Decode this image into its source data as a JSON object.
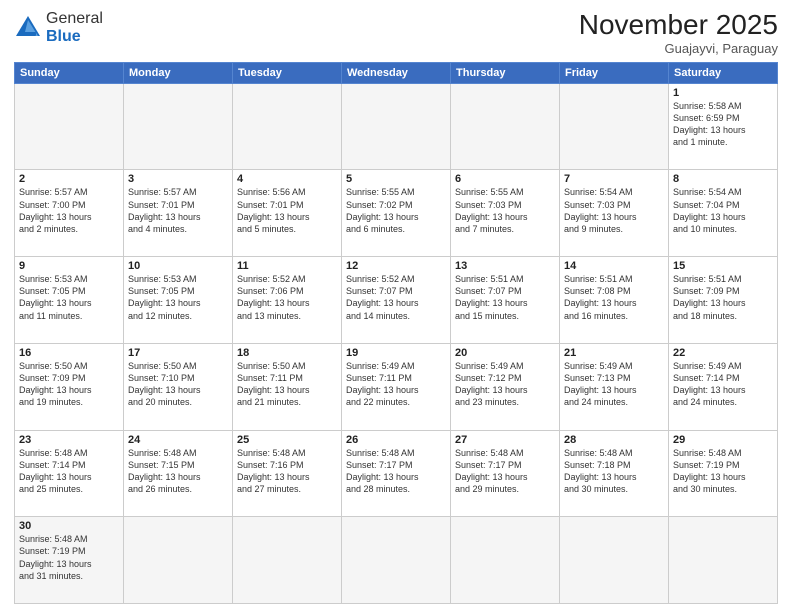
{
  "header": {
    "logo_general": "General",
    "logo_blue": "Blue",
    "month_title": "November 2025",
    "location": "Guajayvi, Paraguay"
  },
  "weekdays": [
    "Sunday",
    "Monday",
    "Tuesday",
    "Wednesday",
    "Thursday",
    "Friday",
    "Saturday"
  ],
  "weeks": [
    [
      {
        "day": "",
        "info": ""
      },
      {
        "day": "",
        "info": ""
      },
      {
        "day": "",
        "info": ""
      },
      {
        "day": "",
        "info": ""
      },
      {
        "day": "",
        "info": ""
      },
      {
        "day": "",
        "info": ""
      },
      {
        "day": "1",
        "info": "Sunrise: 5:58 AM\nSunset: 6:59 PM\nDaylight: 13 hours\nand 1 minute."
      }
    ],
    [
      {
        "day": "2",
        "info": "Sunrise: 5:57 AM\nSunset: 7:00 PM\nDaylight: 13 hours\nand 2 minutes."
      },
      {
        "day": "3",
        "info": "Sunrise: 5:57 AM\nSunset: 7:01 PM\nDaylight: 13 hours\nand 4 minutes."
      },
      {
        "day": "4",
        "info": "Sunrise: 5:56 AM\nSunset: 7:01 PM\nDaylight: 13 hours\nand 5 minutes."
      },
      {
        "day": "5",
        "info": "Sunrise: 5:55 AM\nSunset: 7:02 PM\nDaylight: 13 hours\nand 6 minutes."
      },
      {
        "day": "6",
        "info": "Sunrise: 5:55 AM\nSunset: 7:03 PM\nDaylight: 13 hours\nand 7 minutes."
      },
      {
        "day": "7",
        "info": "Sunrise: 5:54 AM\nSunset: 7:03 PM\nDaylight: 13 hours\nand 9 minutes."
      },
      {
        "day": "8",
        "info": "Sunrise: 5:54 AM\nSunset: 7:04 PM\nDaylight: 13 hours\nand 10 minutes."
      }
    ],
    [
      {
        "day": "9",
        "info": "Sunrise: 5:53 AM\nSunset: 7:05 PM\nDaylight: 13 hours\nand 11 minutes."
      },
      {
        "day": "10",
        "info": "Sunrise: 5:53 AM\nSunset: 7:05 PM\nDaylight: 13 hours\nand 12 minutes."
      },
      {
        "day": "11",
        "info": "Sunrise: 5:52 AM\nSunset: 7:06 PM\nDaylight: 13 hours\nand 13 minutes."
      },
      {
        "day": "12",
        "info": "Sunrise: 5:52 AM\nSunset: 7:07 PM\nDaylight: 13 hours\nand 14 minutes."
      },
      {
        "day": "13",
        "info": "Sunrise: 5:51 AM\nSunset: 7:07 PM\nDaylight: 13 hours\nand 15 minutes."
      },
      {
        "day": "14",
        "info": "Sunrise: 5:51 AM\nSunset: 7:08 PM\nDaylight: 13 hours\nand 16 minutes."
      },
      {
        "day": "15",
        "info": "Sunrise: 5:51 AM\nSunset: 7:09 PM\nDaylight: 13 hours\nand 18 minutes."
      }
    ],
    [
      {
        "day": "16",
        "info": "Sunrise: 5:50 AM\nSunset: 7:09 PM\nDaylight: 13 hours\nand 19 minutes."
      },
      {
        "day": "17",
        "info": "Sunrise: 5:50 AM\nSunset: 7:10 PM\nDaylight: 13 hours\nand 20 minutes."
      },
      {
        "day": "18",
        "info": "Sunrise: 5:50 AM\nSunset: 7:11 PM\nDaylight: 13 hours\nand 21 minutes."
      },
      {
        "day": "19",
        "info": "Sunrise: 5:49 AM\nSunset: 7:11 PM\nDaylight: 13 hours\nand 22 minutes."
      },
      {
        "day": "20",
        "info": "Sunrise: 5:49 AM\nSunset: 7:12 PM\nDaylight: 13 hours\nand 23 minutes."
      },
      {
        "day": "21",
        "info": "Sunrise: 5:49 AM\nSunset: 7:13 PM\nDaylight: 13 hours\nand 24 minutes."
      },
      {
        "day": "22",
        "info": "Sunrise: 5:49 AM\nSunset: 7:14 PM\nDaylight: 13 hours\nand 24 minutes."
      }
    ],
    [
      {
        "day": "23",
        "info": "Sunrise: 5:48 AM\nSunset: 7:14 PM\nDaylight: 13 hours\nand 25 minutes."
      },
      {
        "day": "24",
        "info": "Sunrise: 5:48 AM\nSunset: 7:15 PM\nDaylight: 13 hours\nand 26 minutes."
      },
      {
        "day": "25",
        "info": "Sunrise: 5:48 AM\nSunset: 7:16 PM\nDaylight: 13 hours\nand 27 minutes."
      },
      {
        "day": "26",
        "info": "Sunrise: 5:48 AM\nSunset: 7:17 PM\nDaylight: 13 hours\nand 28 minutes."
      },
      {
        "day": "27",
        "info": "Sunrise: 5:48 AM\nSunset: 7:17 PM\nDaylight: 13 hours\nand 29 minutes."
      },
      {
        "day": "28",
        "info": "Sunrise: 5:48 AM\nSunset: 7:18 PM\nDaylight: 13 hours\nand 30 minutes."
      },
      {
        "day": "29",
        "info": "Sunrise: 5:48 AM\nSunset: 7:19 PM\nDaylight: 13 hours\nand 30 minutes."
      }
    ],
    [
      {
        "day": "30",
        "info": "Sunrise: 5:48 AM\nSunset: 7:19 PM\nDaylight: 13 hours\nand 31 minutes."
      },
      {
        "day": "",
        "info": ""
      },
      {
        "day": "",
        "info": ""
      },
      {
        "day": "",
        "info": ""
      },
      {
        "day": "",
        "info": ""
      },
      {
        "day": "",
        "info": ""
      },
      {
        "day": "",
        "info": ""
      }
    ]
  ]
}
